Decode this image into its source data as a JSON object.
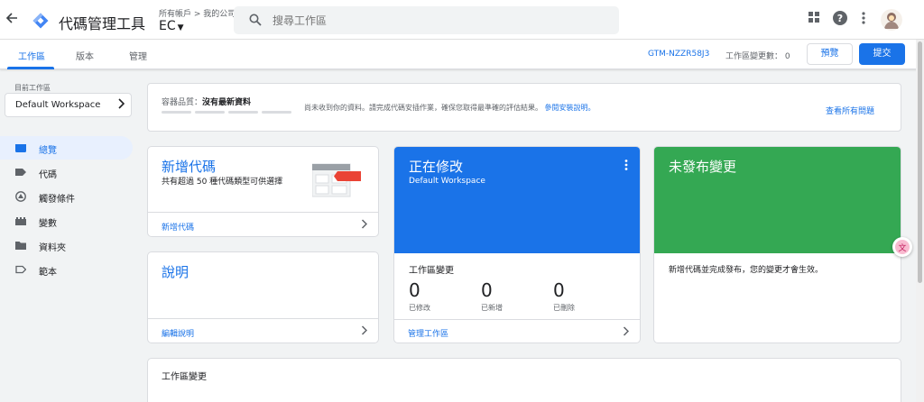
{
  "header": {
    "back_icon": "back-arrow-icon",
    "logo_icon": "gtm-diamond-logo",
    "app_title": "代碼管理工具",
    "breadcrumb": "所有帳戶 > 我的公司",
    "container": "EC",
    "search_placeholder": "搜尋工作區",
    "icons": [
      "apps-grid-icon",
      "help-icon",
      "more-vert-icon"
    ],
    "brand_color": "#1a73e8"
  },
  "subnav": {
    "tabs": [
      "工作區",
      "版本",
      "管理"
    ],
    "active_tab": "工作區",
    "gtm_id": "GTM-NZZR58J3",
    "changes_label": "工作區變更數：",
    "changes_count": "0",
    "preview_label": "預覽",
    "submit_label": "提交"
  },
  "sidebar": {
    "workspace_label": "目前工作區",
    "workspace_name": "Default Workspace",
    "items": [
      {
        "label": "總覽",
        "icon": "overview-icon",
        "active": true
      },
      {
        "label": "代碼",
        "icon": "tag-icon",
        "active": false
      },
      {
        "label": "觸發條件",
        "icon": "trigger-icon",
        "active": false
      },
      {
        "label": "變數",
        "icon": "variable-icon",
        "active": false
      },
      {
        "label": "資料夾",
        "icon": "folder-icon",
        "active": false
      },
      {
        "label": "範本",
        "icon": "template-icon",
        "active": false
      }
    ]
  },
  "status": {
    "quality_label": "容器品質：",
    "quality_value": "沒有最新資料",
    "message": "尚未收到你的資料。請完成代碼安插作業，確保您取得最準確的評估結果。",
    "install_link": "參閱安裝說明。",
    "all_issues": "查看所有問題"
  },
  "cards": {
    "new_tag": {
      "title": "新增代碼",
      "desc": "共有超過 50 種代碼類型可供選擇",
      "link": "新增代碼",
      "accent_color": "#ea4335"
    },
    "help": {
      "title": "說明",
      "link": "編輯說明"
    },
    "editing": {
      "title": "正在修改",
      "subtitle": "Default Workspace",
      "changes_title": "工作區變更",
      "stats": [
        {
          "value": "0",
          "label": "已修改"
        },
        {
          "value": "0",
          "label": "已新增"
        },
        {
          "value": "0",
          "label": "已刪除"
        }
      ],
      "link": "管理工作區",
      "color": "#1a73e8"
    },
    "unpublished": {
      "title": "未發布變更",
      "message": "新增代碼並完成發布，您的變更才會生效。",
      "color": "#34a853"
    },
    "workspace_changes": {
      "title": "工作區變更"
    }
  }
}
